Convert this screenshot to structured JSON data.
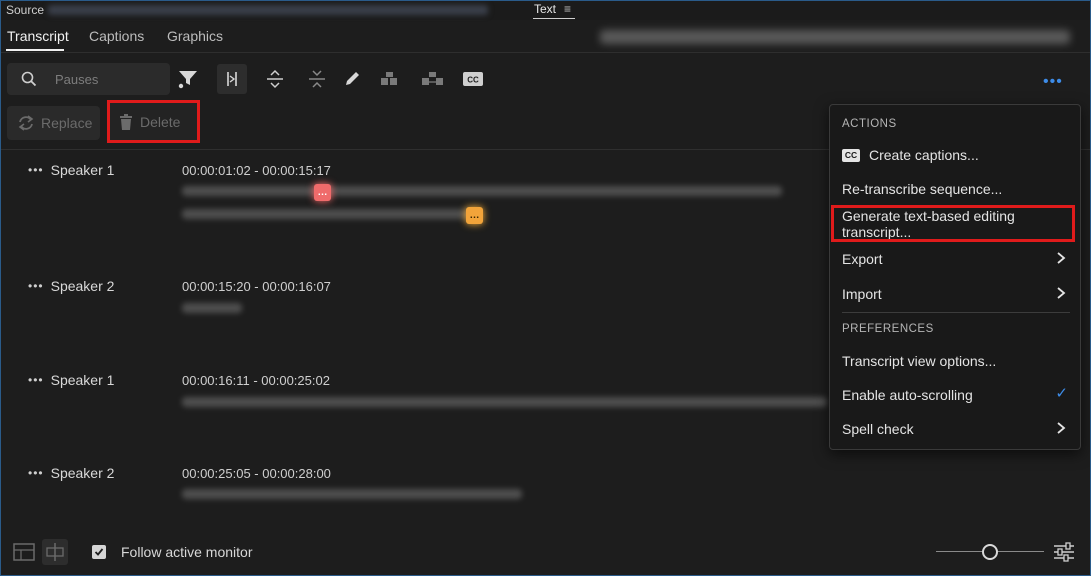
{
  "panel": {
    "source_label": "Source",
    "title": "Text"
  },
  "tabs": [
    {
      "label": "Transcript",
      "active": true
    },
    {
      "label": "Captions",
      "active": false
    },
    {
      "label": "Graphics",
      "active": false
    }
  ],
  "search": {
    "placeholder": "Pauses"
  },
  "toolbar": {
    "icons": [
      "filter-icon",
      "toggle-pauses-icon",
      "expand-icon",
      "collapse-icon",
      "edit-icon",
      "merge-icon",
      "split-icon",
      "cc-icon"
    ],
    "replace_label": "Replace",
    "delete_label": "Delete"
  },
  "transcript": [
    {
      "speaker": "Speaker 1",
      "timecode": "00:00:01:02 - 00:00:15:17"
    },
    {
      "speaker": "Speaker 2",
      "timecode": "00:00:15:20 - 00:00:16:07"
    },
    {
      "speaker": "Speaker 1",
      "timecode": "00:00:16:11 - 00:00:25:02"
    },
    {
      "speaker": "Speaker 2",
      "timecode": "00:00:25:05 - 00:00:28:00"
    }
  ],
  "menu": {
    "actions_heading": "ACTIONS",
    "create_captions": "Create captions...",
    "cc_badge": "CC",
    "retranscribe": "Re-transcribe sequence...",
    "generate": "Generate text-based editing transcript...",
    "export": "Export",
    "import": "Import",
    "preferences_heading": "PREFERENCES",
    "view_options": "Transcript view options...",
    "auto_scrolling": "Enable auto-scrolling",
    "auto_scrolling_checked": true,
    "spell_check": "Spell check"
  },
  "footer": {
    "follow_label": "Follow active monitor",
    "follow_checked": true
  },
  "colors": {
    "accent": "#3d8ce8",
    "highlight": "#e01b1b",
    "pause_red": "#ef6b6b",
    "pause_orange": "#f2a43a"
  }
}
